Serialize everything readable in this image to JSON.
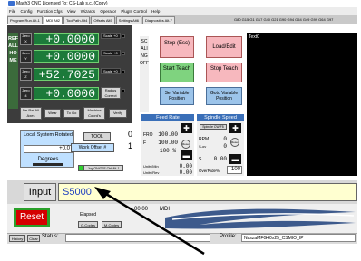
{
  "window": {
    "title": "Mach3 CNC  Licensed To: CS-Lab s.c.  (Copy)"
  },
  "menu": [
    "File",
    "Config",
    "Function Cfgs",
    "View",
    "Wizards",
    "Operator",
    "PlugIn Control",
    "Help"
  ],
  "tabs": [
    "Program Run Alt-1",
    "MDI Alt2",
    "ToolPath Alt4",
    "Offsets Alt5",
    "Settings Alt6",
    "Diagnostics Alt-7"
  ],
  "gcode_modal": "G80 G15  G1 G17 G40 G21 G90 G94 G54 G49 G99 G64 G97",
  "ref_label": "REFALLHOME",
  "axes": [
    {
      "label": "Zero X",
      "value": "+0.0000",
      "scale": "Scale +0"
    },
    {
      "label": "Zero Y",
      "value": "+0.0000",
      "scale": "Scale +0"
    },
    {
      "label": "Zero Z",
      "value": "+52.7025",
      "scale": "Scale +0"
    },
    {
      "label": "Zero 4",
      "value": "+0.0000",
      "scale": "Radius Correct"
    }
  ],
  "dro_buttons": [
    "De-Ref All Axes",
    "Wear",
    "To Go",
    "Machine Coord's",
    "Verify"
  ],
  "side_label": "SCALING OFF",
  "buttons": {
    "stop": "Stop (Esc)",
    "load_edit": "Load/Edit",
    "start_teach": "Start Teach",
    "stop_teach": "Stop Teach",
    "set_variable": "Set Variable Position",
    "goto_variable": "Goto Variable Position"
  },
  "gcode_view": "Text0",
  "local_system": "Local System Rotated",
  "local_value": "+0.0",
  "degrees": "Degrees",
  "tool_label": "TOOL",
  "tool_value": "0",
  "work_offset_label": "Work Offset #",
  "work_offset_value": "1",
  "jog_label": "Jog ON/OFF Ctrl-Alt-J",
  "feed": {
    "title": "Feed Rate",
    "fro_label": "FRO",
    "fro_value": "100.00",
    "f_label": "F",
    "f_value": "100.00",
    "percent": "100 %",
    "units_min_label": "Units/Min",
    "units_min_value": "0.00",
    "units_rev_label": "Units/Rev",
    "units_rev_value": "0.00"
  },
  "spindle": {
    "title": "Spindle Speed",
    "cwf5": "Spindle CW F5",
    "rpm_label": "RPM",
    "rpm_value": "0",
    "sov_label": "S-ov",
    "sov_value": "0",
    "s_label": "S",
    "s_value": "0.00",
    "override_label": "OverRide%",
    "override_value": "100"
  },
  "input": {
    "label": "Input",
    "value": "S5000"
  },
  "reset": "Reset",
  "elapsed_label": "Elapsed",
  "elapsed_value": "00:00",
  "mdi_label": "MDI",
  "gcodes": "G-Codes",
  "mcodes": "M-Codes",
  "history": "History",
  "clear": "Clear",
  "status_label": "Status:",
  "profile_label": "Profile:",
  "profile_value": "NaszaMFG40x25_CSMIO_IP"
}
